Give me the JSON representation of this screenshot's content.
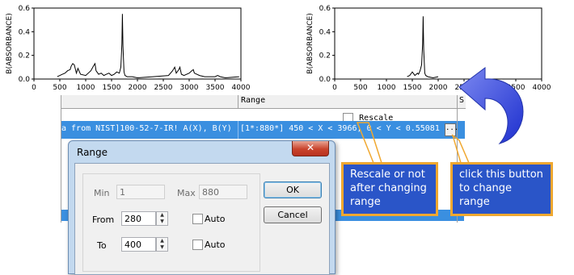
{
  "left_chart": {
    "ylabel": "B(ABSORBANCE)",
    "yticks": [
      "0.6",
      "0.4",
      "0.2",
      "0.0"
    ],
    "xticks": [
      "0",
      "500",
      "1000",
      "1500",
      "2000",
      "2500",
      "3000",
      "3500",
      "4000"
    ]
  },
  "right_chart": {
    "ylabel": "B(ABSORBANCE)",
    "yticks": [
      "0.6",
      "0.4",
      "0.2",
      "0.0"
    ],
    "xticks": [
      "0",
      "500",
      "1000",
      "1500",
      "2000",
      "2500",
      "3000",
      "3500",
      "4000"
    ]
  },
  "chart_data": [
    {
      "type": "line",
      "xlabel": "",
      "ylabel": "B(ABSORBANCE)",
      "xlim": [
        0,
        4000
      ],
      "ylim": [
        0,
        0.6
      ],
      "series": [
        {
          "x": [
            450,
            550,
            600,
            650,
            700,
            720,
            750,
            780,
            820,
            850,
            900,
            1000,
            1100,
            1150,
            1180,
            1200,
            1250,
            1300,
            1350,
            1400,
            1450,
            1500,
            1550,
            1600,
            1650,
            1680,
            1700,
            1710,
            1720,
            1740,
            1760,
            1800,
            1900,
            2000,
            2300,
            2600,
            2680,
            2720,
            2750,
            2800,
            2820,
            2850,
            2900,
            3000,
            3050,
            3080,
            3100,
            3200,
            3300,
            3500,
            3550,
            3600,
            3700,
            3966
          ],
          "y": [
            0.02,
            0.04,
            0.05,
            0.07,
            0.08,
            0.11,
            0.13,
            0.12,
            0.05,
            0.09,
            0.04,
            0.03,
            0.07,
            0.11,
            0.13,
            0.07,
            0.04,
            0.05,
            0.03,
            0.04,
            0.05,
            0.03,
            0.04,
            0.06,
            0.05,
            0.1,
            0.3,
            0.55,
            0.28,
            0.06,
            0.03,
            0.02,
            0.02,
            0.01,
            0.02,
            0.03,
            0.07,
            0.1,
            0.05,
            0.08,
            0.1,
            0.04,
            0.03,
            0.05,
            0.07,
            0.08,
            0.05,
            0.03,
            0.02,
            0.02,
            0.03,
            0.02,
            0.01,
            0.02
          ]
        }
      ]
    },
    {
      "type": "line",
      "xlabel": "",
      "ylabel": "B(ABSORBANCE)",
      "xlim": [
        0,
        4000
      ],
      "ylim": [
        0,
        0.6
      ],
      "series": [
        {
          "x": [
            1400,
            1450,
            1500,
            1550,
            1600,
            1620,
            1650,
            1680,
            1700,
            1710,
            1720,
            1740,
            1760,
            1800,
            1900,
            2000
          ],
          "y": [
            0.02,
            0.03,
            0.06,
            0.03,
            0.05,
            0.04,
            0.07,
            0.12,
            0.3,
            0.53,
            0.25,
            0.05,
            0.03,
            0.02,
            0.01,
            0.02
          ]
        }
      ]
    }
  ],
  "sheet": {
    "col_header": "Range",
    "col_header_right": "S",
    "rescale_label": "Rescale",
    "row_text_left": "a from NIST]100-52-7-IR! A(X), B(Y)",
    "row_text_range": "[1*:880*]  450 < X < 3966, 0 < Y < 0.55081",
    "ellipsis": "..."
  },
  "dialog": {
    "title": "Range",
    "close_symbol": "✕",
    "min_label": "Min",
    "min_value": "1",
    "max_label": "Max",
    "max_value": "880",
    "from_label": "From",
    "from_value": "280",
    "to_label": "To",
    "to_value": "400",
    "auto_label": "Auto",
    "ok_label": "OK",
    "cancel_label": "Cancel"
  },
  "callouts": {
    "rescale_note": "Rescale or not after changing range",
    "button_note": "click this button to change range"
  },
  "colors": {
    "selection": "#3a8fe0",
    "callout_fill": "#2a55c8",
    "callout_border": "#f0a830",
    "arrow": "#3344dd"
  }
}
